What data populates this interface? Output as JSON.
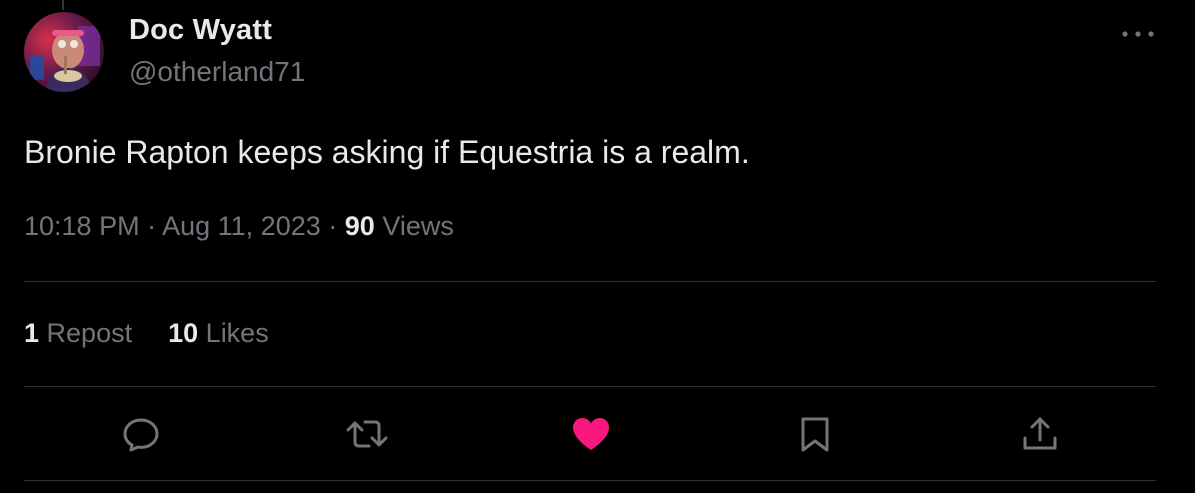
{
  "tweet": {
    "author": {
      "display_name": "Doc Wyatt",
      "handle": "@otherland71",
      "avatar_icon": "user-avatar-photo"
    },
    "text": "Bronie Rapton keeps asking if Equestria is a realm.",
    "time": "10:18 PM",
    "date": "Aug 11, 2023",
    "separator": "·",
    "views_count": "90",
    "views_label": "Views"
  },
  "stats": {
    "reposts_count": "1",
    "reposts_label": "Repost",
    "likes_count": "10",
    "likes_label": "Likes"
  },
  "actions": [
    {
      "name": "reply",
      "icon": "speech-bubble-icon",
      "color": "#71767b"
    },
    {
      "name": "repost",
      "icon": "repost-arrows-icon",
      "color": "#71767b"
    },
    {
      "name": "like",
      "icon": "heart-icon",
      "color": "#f91880",
      "active": true
    },
    {
      "name": "bookmark",
      "icon": "bookmark-icon",
      "color": "#71767b"
    },
    {
      "name": "share",
      "icon": "upload-share-icon",
      "color": "#71767b"
    }
  ],
  "colors": {
    "background": "#000000",
    "primary_text": "#e7e9ea",
    "secondary_text": "#71767b",
    "divider": "#2f3336",
    "like_active": "#f91880"
  }
}
